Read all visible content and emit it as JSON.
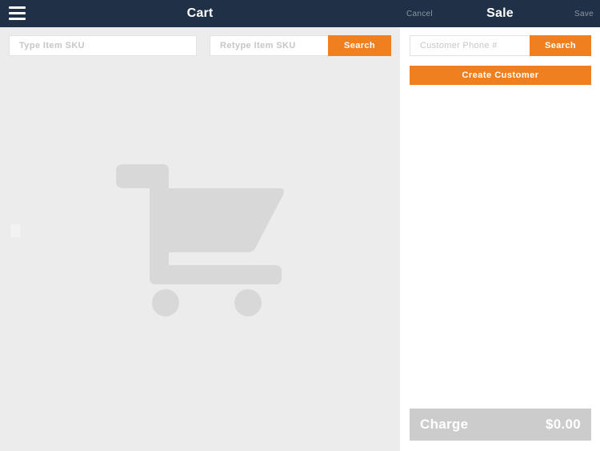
{
  "header": {
    "menu_icon": "hamburger-menu-icon",
    "cart_title": "Cart",
    "sale_title": "Sale",
    "cancel_label": "Cancel",
    "save_label": "Save",
    "background_color": "#1f3047",
    "title_color": "#ffffff",
    "action_color": "#8d96a3"
  },
  "cart_panel": {
    "background_color": "#ececec",
    "sku_input_1": {
      "placeholder": "Type Item SKU",
      "value": ""
    },
    "sku_input_2": {
      "placeholder": "Retype Item SKU",
      "value": ""
    },
    "search_label": "Search",
    "empty_illustration": "shopping-cart-icon",
    "illustration_color": "#d8d8d8"
  },
  "sale_panel": {
    "background_color": "#ffffff",
    "phone_input": {
      "placeholder": "Customer Phone #",
      "value": ""
    },
    "search_label": "Search",
    "create_customer_label": "Create Customer",
    "charge": {
      "label": "Charge",
      "amount": "$0.00",
      "background_color": "#cccccc"
    }
  },
  "theme": {
    "accent_color": "#f07f20",
    "navy": "#1f3047",
    "panel_gray": "#ececec",
    "muted_gray": "#cccccc"
  }
}
